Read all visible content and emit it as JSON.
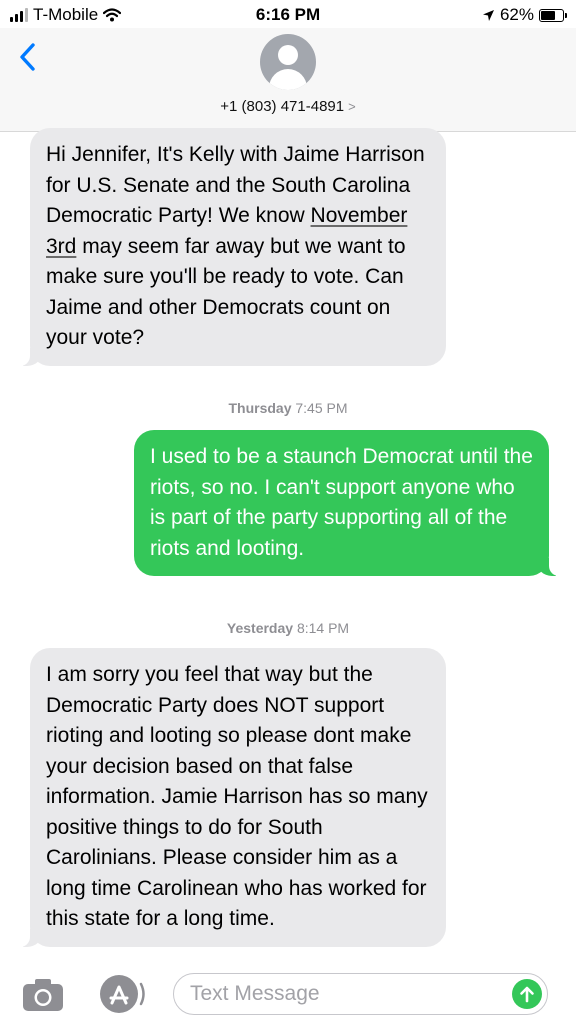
{
  "status_bar": {
    "carrier": "T-Mobile",
    "time": "6:16 PM",
    "battery": "62%",
    "battery_level": 0.62,
    "icons": [
      "signal-icon",
      "wifi-icon",
      "location-arrow-icon",
      "battery-icon"
    ]
  },
  "header": {
    "contact": "+1 (803) 471-4891",
    "chevron": ">"
  },
  "messages": [
    {
      "direction": "incoming",
      "text_before": "Hi Jennifer, It's Kelly with Jaime Harrison for U.S. Senate and the South Carolina Democratic Party! We know ",
      "link_text": "November 3rd",
      "text_after": " may seem far away but we want to make sure you'll be ready to vote. Can Jaime and other Democrats count on your vote?"
    },
    {
      "type": "timestamp",
      "day": "Thursday",
      "time": "7:45 PM"
    },
    {
      "direction": "outgoing",
      "text": "I used to be a staunch Democrat until the riots, so no. I can't support anyone who is part of the party supporting all of the riots and looting."
    },
    {
      "type": "timestamp",
      "day": "Yesterday",
      "time": "8:14 PM"
    },
    {
      "direction": "incoming",
      "text": "I am sorry you feel that way but the Democratic Party does NOT support rioting and looting so please dont make your decision based on that false information. Jamie Harrison has so many positive things to do for South Carolinians. Please consider him as a long time Carolinean who has worked for this state for a long time."
    }
  ],
  "input_bar": {
    "placeholder": "Text Message",
    "value": ""
  },
  "colors": {
    "incoming_bubble": "#e9e9eb",
    "outgoing_bubble": "#34c759",
    "accent_blue": "#007aff",
    "timestamp_gray": "#8e8e93"
  }
}
